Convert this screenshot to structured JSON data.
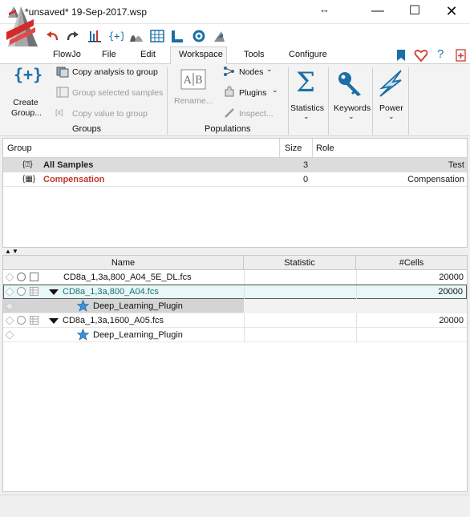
{
  "window": {
    "title": "*unsaved* 19-Sep-2017.wsp",
    "resize_glyph": "↔",
    "minimize_glyph": "—",
    "maximize_glyph": "☐",
    "close_glyph": "✕"
  },
  "quick_toolbar": {
    "icons": [
      "undo-icon",
      "redo-icon",
      "layout-editor-icon",
      "equation-editor-icon",
      "overlay-histogram-icon",
      "table-editor-icon",
      "layout-l-icon",
      "sync-icon",
      "plot-icon"
    ]
  },
  "menu": {
    "items": [
      "FlowJo",
      "File",
      "Edit",
      "Workspace",
      "Tools",
      "Configure"
    ],
    "active": "Workspace",
    "right_icons": [
      "bookmark-icon",
      "heart-icon",
      "help-icon",
      "new-document-icon"
    ],
    "help_glyph": "?"
  },
  "ribbon": {
    "create_group_line1": "Create",
    "create_group_line2": "Group...",
    "create_group_glyph": "{+}",
    "copy_analysis": "Copy analysis to group",
    "group_selected": "Group selected samples",
    "copy_value": "Copy value to group",
    "groups_label": "Groups",
    "rename": "Rename...",
    "rename_glyph": "A⫿B",
    "nodes": "Nodes",
    "plugins": "Plugins",
    "inspect": "Inspect...",
    "populations_label": "Populations",
    "statistics": "Statistics",
    "statistics_glyph": "Σ",
    "keywords": "Keywords",
    "power": "Power",
    "chevron": "⌄",
    "accent": "#1b6fa6"
  },
  "group_table": {
    "headers": [
      "Group",
      "Size",
      "Role"
    ],
    "rows": [
      {
        "name": "All Samples",
        "size": "3",
        "role": "Test"
      },
      {
        "name": "Compensation",
        "size": "0",
        "role": "Compensation"
      }
    ],
    "all_samples_glyph": "{⍰}",
    "compensation_glyph": "{▦}",
    "compensation_color": "#c0392b"
  },
  "splitter": {
    "up_glyph": "▲",
    "down_glyph": "▼"
  },
  "sample_table": {
    "headers": [
      "Name",
      "Statistic",
      "#Cells"
    ],
    "rows": [
      {
        "name": "CD8a_1,3a,800_A04_5E_DL.fcs",
        "statistic": "",
        "cells": "20000"
      },
      {
        "name": "CD8a_1,3a,800_A04.fcs",
        "statistic": "",
        "cells": "20000"
      },
      {
        "name": "Deep_Learning_Plugin",
        "statistic": "",
        "cells": ""
      },
      {
        "name": "CD8a_1,3a,1600_A05.fcs",
        "statistic": "",
        "cells": "20000"
      },
      {
        "name": "Deep_Learning_Plugin",
        "statistic": "",
        "cells": ""
      }
    ],
    "selected_row_color": "#e8f8f8",
    "child_row_color": "#d4d4d4"
  }
}
